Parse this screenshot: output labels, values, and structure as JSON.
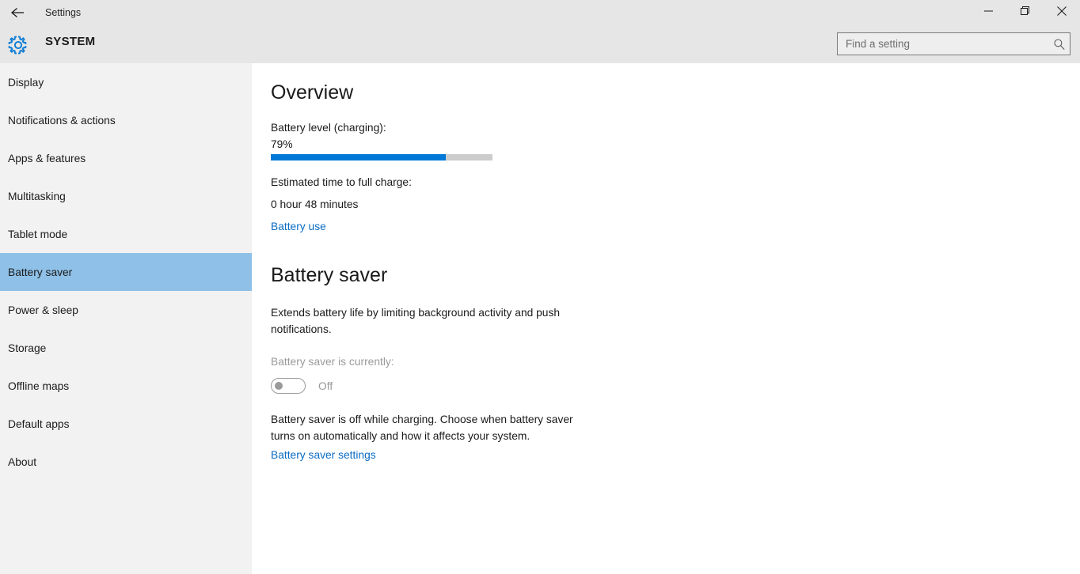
{
  "window": {
    "title": "Settings",
    "back_icon": "back-arrow-icon",
    "minimize_icon": "minimize-icon",
    "restore_icon": "restore-icon",
    "close_icon": "close-icon"
  },
  "header": {
    "category": "SYSTEM",
    "gear_icon": "gear-icon",
    "accent_color": "#0078d7"
  },
  "search": {
    "placeholder": "Find a setting",
    "value": "",
    "icon": "search-icon"
  },
  "sidebar": {
    "selected_color": "#8fc1e8",
    "items": [
      {
        "label": "Display",
        "selected": false
      },
      {
        "label": "Notifications & actions",
        "selected": false
      },
      {
        "label": "Apps & features",
        "selected": false
      },
      {
        "label": "Multitasking",
        "selected": false
      },
      {
        "label": "Tablet mode",
        "selected": false
      },
      {
        "label": "Battery saver",
        "selected": true
      },
      {
        "label": "Power & sleep",
        "selected": false
      },
      {
        "label": "Storage",
        "selected": false
      },
      {
        "label": "Offline maps",
        "selected": false
      },
      {
        "label": "Default apps",
        "selected": false
      },
      {
        "label": "About",
        "selected": false
      }
    ]
  },
  "overview": {
    "heading": "Overview",
    "battery_level_label": "Battery level (charging):",
    "battery_level_value": "79%",
    "battery_percent": 79,
    "estimated_time_label": "Estimated time to full charge:",
    "estimated_time_value": "0 hour 48 minutes",
    "battery_use_link": "Battery use",
    "bar_fill_color": "#0078d7",
    "bar_track_color": "#cccccc"
  },
  "battery_saver": {
    "heading": "Battery saver",
    "description": "Extends battery life by limiting background activity and push notifications.",
    "status_label": "Battery saver is currently:",
    "toggle_state": "Off",
    "toggle_on": false,
    "note": "Battery saver is off while charging. Choose when battery saver turns on automatically and how it affects your system.",
    "settings_link": "Battery saver settings"
  }
}
